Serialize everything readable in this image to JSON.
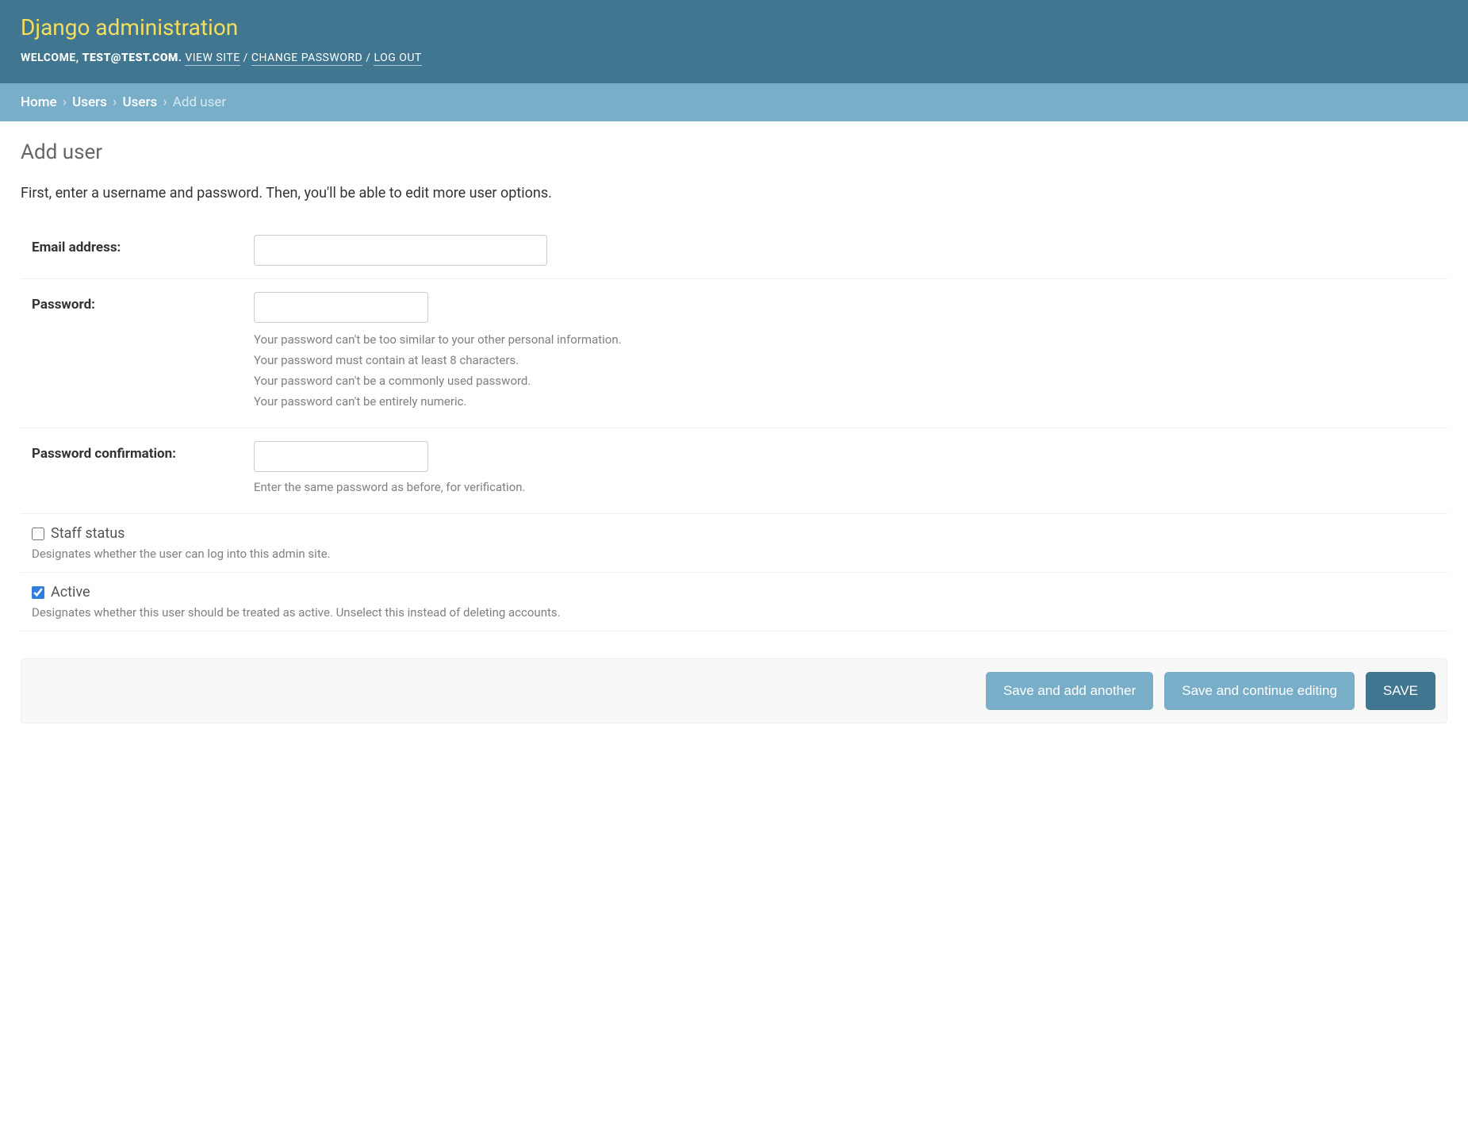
{
  "header": {
    "branding": "Django administration",
    "welcome_prefix": "WELCOME, ",
    "username": "TEST@TEST.COM",
    "view_site": "VIEW SITE",
    "change_password": "CHANGE PASSWORD",
    "log_out": "LOG OUT"
  },
  "breadcrumbs": {
    "home": "Home",
    "app": "Users",
    "model": "Users",
    "current": "Add user"
  },
  "page": {
    "title": "Add user",
    "intro": "First, enter a username and password. Then, you'll be able to edit more user options."
  },
  "fields": {
    "email": {
      "label": "Email address:",
      "value": ""
    },
    "password": {
      "label": "Password:",
      "value": "",
      "help": [
        "Your password can't be too similar to your other personal information.",
        "Your password must contain at least 8 characters.",
        "Your password can't be a commonly used password.",
        "Your password can't be entirely numeric."
      ]
    },
    "password_confirm": {
      "label": "Password confirmation:",
      "value": "",
      "help": "Enter the same password as before, for verification."
    },
    "staff_status": {
      "label": "Staff status",
      "checked": false,
      "help": "Designates whether the user can log into this admin site."
    },
    "active": {
      "label": "Active",
      "checked": true,
      "help": "Designates whether this user should be treated as active. Unselect this instead of deleting accounts."
    }
  },
  "buttons": {
    "save_add_another": "Save and add another",
    "save_continue": "Save and continue editing",
    "save": "SAVE"
  }
}
